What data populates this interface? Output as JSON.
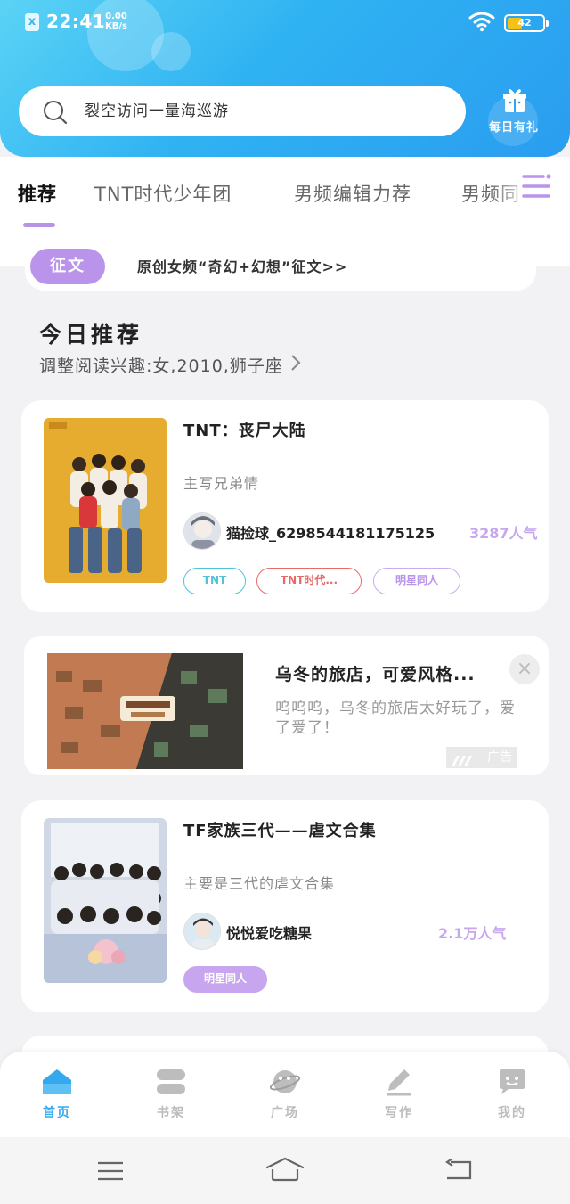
{
  "status_bar": {
    "time": "22:41",
    "speed_value": "0.00",
    "speed_unit": "KB/s",
    "battery": "42",
    "battery_level": 0.42
  },
  "search": {
    "placeholder": "裂空访问一量海巡游"
  },
  "daily_gift": {
    "label": "每日有礼"
  },
  "tabs": [
    {
      "label": "推荐",
      "active": true
    },
    {
      "label": "TNT时代少年团",
      "active": false
    },
    {
      "label": "男频编辑力荐",
      "active": false
    },
    {
      "label": "男频同",
      "active": false
    }
  ],
  "contest": {
    "badge": "征文",
    "text": "原创女频“奇幻+幻想”征文>>"
  },
  "section": {
    "title": "今日推荐",
    "subtitle": "调整阅读兴趣:女,2010,狮子座"
  },
  "books": [
    {
      "title": "TNT：丧尸大陆",
      "desc": "主写兄弟情",
      "author": "猫捡球_6298544181175125",
      "popularity": "3287人气",
      "tags": [
        "TNT",
        "TNT时代...",
        "明星同人"
      ]
    },
    {
      "title": "TF家族三代——虐文合集",
      "desc": "主要是三代的虐文合集",
      "author": "悦悦爱吃糖果",
      "popularity": "2.1万人气",
      "tags": [
        "明星同人"
      ]
    }
  ],
  "ad": {
    "title": "乌冬的旅店，可爱风格...",
    "desc": "呜呜呜，乌冬的旅店太好玩了，爱了爱了！",
    "label": "广告",
    "close": "×"
  },
  "bottom_nav": [
    {
      "label": "首页",
      "icon": "home-icon",
      "active": true
    },
    {
      "label": "书架",
      "icon": "bookshelf-icon",
      "active": false
    },
    {
      "label": "广场",
      "icon": "planet-icon",
      "active": false
    },
    {
      "label": "写作",
      "icon": "pen-icon",
      "active": false
    },
    {
      "label": "我的",
      "icon": "chat-face-icon",
      "active": false
    }
  ],
  "colors": {
    "header": "#2fb2f2",
    "accent": "#b994ea",
    "active_nav": "#35a9ee"
  }
}
